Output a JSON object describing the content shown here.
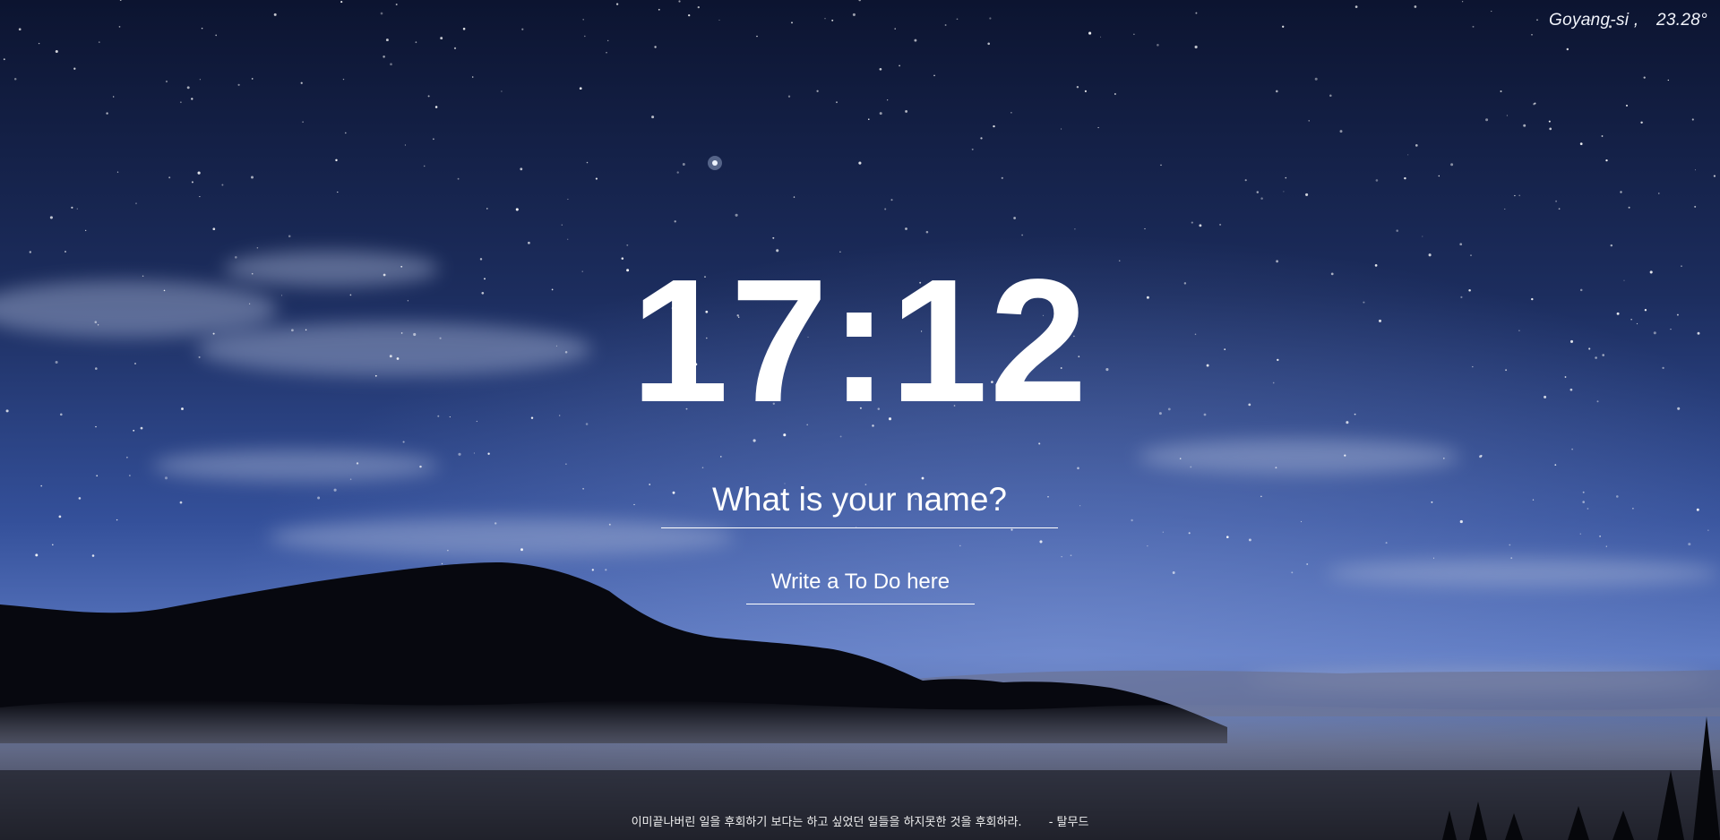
{
  "weather": {
    "location": "Goyang-si ,",
    "temperature": "23.28°"
  },
  "clock": {
    "time": "17:12"
  },
  "greeting": {
    "placeholder": "What is your name?"
  },
  "todo": {
    "placeholder": "Write a To Do here"
  },
  "quote": {
    "text": "이미끝나버린 일을 후회하기 보다는 하고 싶었던 일들을 하지못한 것을 후회하라.",
    "author": "- 탈무드"
  },
  "background": {
    "description": "night sky with stars over mountain and fog",
    "sky_top": "#0e1733",
    "sky_mid": "#2b4486",
    "sky_low": "#5a78c2",
    "mountain": "#07080f"
  }
}
